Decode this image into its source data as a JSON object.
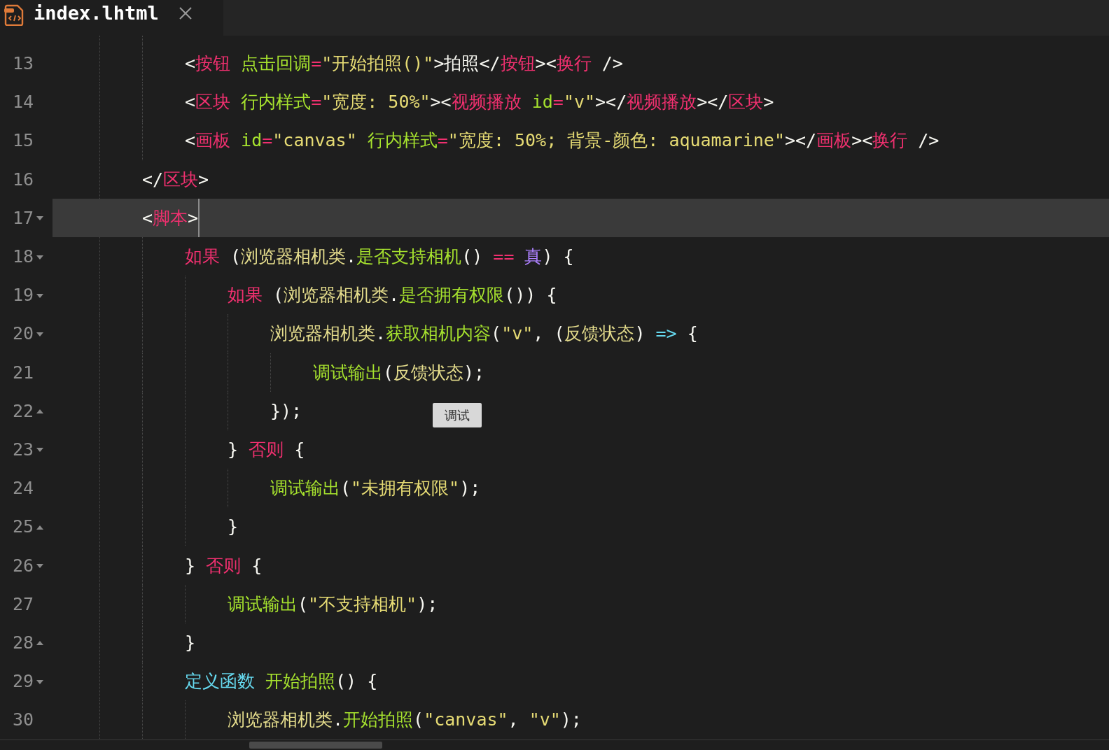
{
  "tab": {
    "title": "index.lhtml",
    "selected": true
  },
  "code": [
    {
      "children": [
        {
          "number": "13",
          "current": false,
          "tokens": [
            {
              "kind": "punct",
              "text": "<"
            },
            {
              "kind": "tag",
              "text": "按钮"
            },
            {
              "kind": "attr",
              "text": " 点击回调"
            },
            {
              "kind": "op",
              "text": "="
            },
            {
              "kind": "string",
              "text": "\"开始拍照()\""
            },
            {
              "kind": "punct",
              "text": ">"
            },
            {
              "kind": "text",
              "text": "拍照"
            },
            {
              "kind": "punct",
              "text": "</"
            },
            {
              "kind": "tag",
              "text": "按钮"
            },
            {
              "kind": "punct",
              "text": "><"
            },
            {
              "kind": "tag",
              "text": "换行"
            },
            {
              "kind": "punct",
              "text": " />"
            }
          ]
        },
        {
          "number": "14",
          "current": false,
          "tokens": [
            {
              "kind": "punct",
              "text": "<"
            },
            {
              "kind": "tag",
              "text": "区块"
            },
            {
              "kind": "attr",
              "text": " 行内样式"
            },
            {
              "kind": "op",
              "text": "="
            },
            {
              "kind": "string",
              "text": "\"宽度: 50%\""
            },
            {
              "kind": "punct",
              "text": "><"
            },
            {
              "kind": "tag",
              "text": "视频播放"
            },
            {
              "kind": "attr",
              "text": " id"
            },
            {
              "kind": "op",
              "text": "="
            },
            {
              "kind": "string",
              "text": "\"v\""
            },
            {
              "kind": "punct",
              "text": "></"
            },
            {
              "kind": "tag",
              "text": "视频播放"
            },
            {
              "kind": "punct",
              "text": "></"
            },
            {
              "kind": "tag",
              "text": "区块"
            },
            {
              "kind": "punct",
              "text": ">"
            }
          ]
        },
        {
          "number": "15",
          "current": false,
          "tokens": [
            {
              "kind": "punct",
              "text": "<"
            },
            {
              "kind": "tag",
              "text": "画板"
            },
            {
              "kind": "attr",
              "text": " id"
            },
            {
              "kind": "op",
              "text": "="
            },
            {
              "kind": "string",
              "text": "\"canvas\""
            },
            {
              "kind": "attr",
              "text": " 行内样式"
            },
            {
              "kind": "op",
              "text": "="
            },
            {
              "kind": "string",
              "text": "\"宽度: 50%; 背景-颜色: aquamarine\""
            },
            {
              "kind": "punct",
              "text": "></"
            },
            {
              "kind": "tag",
              "text": "画板"
            },
            {
              "kind": "punct",
              "text": "><"
            },
            {
              "kind": "tag",
              "text": "换行"
            },
            {
              "kind": "punct",
              "text": " />"
            }
          ]
        }
      ]
    },
    {
      "number": "16",
      "current": false,
      "tokens": [
        {
          "kind": "punct",
          "text": "</"
        },
        {
          "kind": "tag",
          "text": "区块"
        },
        {
          "kind": "punct",
          "text": ">"
        }
      ]
    },
    {
      "number": "17",
      "fold_start": true,
      "current": true,
      "tokens": [
        {
          "kind": "punct",
          "text": "<"
        },
        {
          "kind": "tag",
          "text": "脚本"
        },
        {
          "kind": "punct",
          "text": ">"
        }
      ],
      "children": [
        {
          "number": "18",
          "fold_start": true,
          "current": false,
          "tokens": [
            {
              "kind": "keyword",
              "text": "如果"
            },
            {
              "kind": "punct",
              "text": " ("
            },
            {
              "kind": "variable",
              "text": "浏览器相机类"
            },
            {
              "kind": "punct",
              "text": "."
            },
            {
              "kind": "func",
              "text": "是否支持相机"
            },
            {
              "kind": "punct",
              "text": "() "
            },
            {
              "kind": "op",
              "text": "== "
            },
            {
              "kind": "constant",
              "text": "真"
            },
            {
              "kind": "punct",
              "text": ") {"
            }
          ],
          "children": [
            {
              "number": "19",
              "fold_start": true,
              "current": false,
              "tokens": [
                {
                  "kind": "keyword",
                  "text": "如果"
                },
                {
                  "kind": "punct",
                  "text": " ("
                },
                {
                  "kind": "variable",
                  "text": "浏览器相机类"
                },
                {
                  "kind": "punct",
                  "text": "."
                },
                {
                  "kind": "func",
                  "text": "是否拥有权限"
                },
                {
                  "kind": "punct",
                  "text": "()) {"
                }
              ],
              "children": [
                {
                  "number": "20",
                  "fold_start": true,
                  "current": false,
                  "tokens": [
                    {
                      "kind": "variable",
                      "text": "浏览器相机类"
                    },
                    {
                      "kind": "punct",
                      "text": "."
                    },
                    {
                      "kind": "func",
                      "text": "获取相机内容"
                    },
                    {
                      "kind": "punct",
                      "text": "("
                    },
                    {
                      "kind": "string",
                      "text": "\"v\""
                    },
                    {
                      "kind": "punct",
                      "text": ", ("
                    },
                    {
                      "kind": "variable",
                      "text": "反馈状态"
                    },
                    {
                      "kind": "punct",
                      "text": ") "
                    },
                    {
                      "kind": "storage",
                      "text": "=>"
                    },
                    {
                      "kind": "punct",
                      "text": " {"
                    }
                  ],
                  "children": [
                    {
                      "number": "21",
                      "current": false,
                      "tokens": [
                        {
                          "kind": "func",
                          "text": "调试输出"
                        },
                        {
                          "kind": "punct",
                          "text": "("
                        },
                        {
                          "kind": "variable",
                          "text": "反馈状态"
                        },
                        {
                          "kind": "punct",
                          "text": ");"
                        }
                      ]
                    }
                  ]
                },
                {
                  "number": "22",
                  "fold_end": true,
                  "current": false,
                  "tokens": [
                    {
                      "kind": "punct",
                      "text": "});"
                    }
                  ]
                }
              ]
            },
            {
              "number": "23",
              "fold_start": true,
              "current": false,
              "tokens": [
                {
                  "kind": "punct",
                  "text": "} "
                },
                {
                  "kind": "keyword",
                  "text": "否则"
                },
                {
                  "kind": "punct",
                  "text": " {"
                }
              ],
              "children": [
                {
                  "number": "24",
                  "current": false,
                  "tokens": [
                    {
                      "kind": "func",
                      "text": "调试输出"
                    },
                    {
                      "kind": "punct",
                      "text": "("
                    },
                    {
                      "kind": "string",
                      "text": "\"未拥有权限\""
                    },
                    {
                      "kind": "punct",
                      "text": ");"
                    }
                  ]
                }
              ]
            },
            {
              "number": "25",
              "fold_end": true,
              "current": false,
              "tokens": [
                {
                  "kind": "punct",
                  "text": "}"
                }
              ]
            }
          ]
        },
        {
          "number": "26",
          "fold_start": true,
          "current": false,
          "tokens": [
            {
              "kind": "punct",
              "text": "} "
            },
            {
              "kind": "keyword",
              "text": "否则"
            },
            {
              "kind": "punct",
              "text": " {"
            }
          ],
          "children": [
            {
              "number": "27",
              "current": false,
              "tokens": [
                {
                  "kind": "func",
                  "text": "调试输出"
                },
                {
                  "kind": "punct",
                  "text": "("
                },
                {
                  "kind": "string",
                  "text": "\"不支持相机\""
                },
                {
                  "kind": "punct",
                  "text": ");"
                }
              ]
            }
          ]
        },
        {
          "number": "28",
          "fold_end": true,
          "current": false,
          "tokens": [
            {
              "kind": "punct",
              "text": "}"
            }
          ]
        },
        {
          "number": "29",
          "fold_start": true,
          "current": false,
          "tokens": [
            {
              "kind": "storage",
              "text": "定义函数 "
            },
            {
              "kind": "func",
              "text": "开始拍照"
            },
            {
              "kind": "punct",
              "text": "() {"
            }
          ],
          "children": [
            {
              "number": "30",
              "current": false,
              "tokens": [
                {
                  "kind": "variable",
                  "text": "浏览器相机类"
                },
                {
                  "kind": "punct",
                  "text": "."
                },
                {
                  "kind": "func",
                  "text": "开始拍照"
                },
                {
                  "kind": "punct",
                  "text": "("
                },
                {
                  "kind": "string",
                  "text": "\"canvas\""
                },
                {
                  "kind": "punct",
                  "text": ", "
                },
                {
                  "kind": "string",
                  "text": "\"v\""
                },
                {
                  "kind": "punct",
                  "text": ");"
                }
              ]
            }
          ]
        }
      ]
    }
  ],
  "tooltip": {
    "text": "调试"
  }
}
